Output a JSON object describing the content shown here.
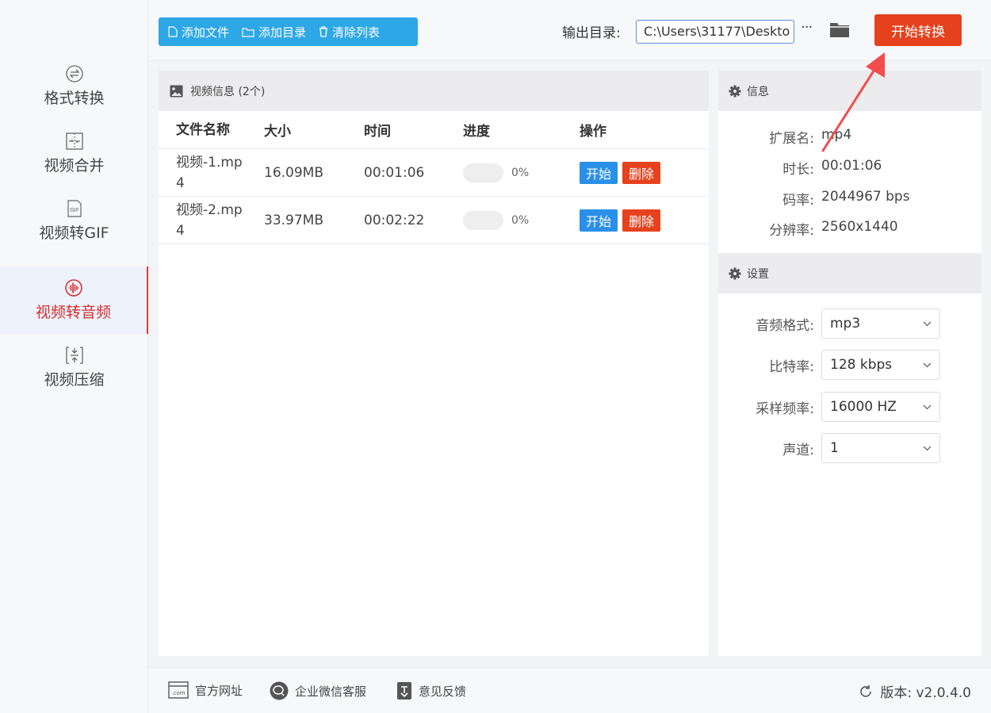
{
  "sidebar": {
    "items": [
      {
        "label": "格式转换",
        "icon": "format-convert-icon",
        "active": false
      },
      {
        "label": "视频合并",
        "icon": "video-merge-icon",
        "active": false
      },
      {
        "label": "视频转GIF",
        "icon": "gif-icon",
        "active": false
      },
      {
        "label": "视频转音频",
        "icon": "audio-wave-icon",
        "active": true
      },
      {
        "label": "视频压缩",
        "icon": "compress-icon",
        "active": false
      }
    ],
    "gif_icon_text": "GIF"
  },
  "toolbar": {
    "add_file": "添加文件",
    "add_folder": "添加目录",
    "clear_list": "清除列表",
    "output_label": "输出目录:",
    "output_path": "C:\\Users\\31177\\Deskto",
    "more": "···",
    "start_convert": "开始转换"
  },
  "file_panel": {
    "title": "视频信息 (2个)",
    "columns": [
      "文件名称",
      "大小",
      "时间",
      "进度",
      "操作"
    ],
    "rows": [
      {
        "name_line1": "视频-1.mp",
        "name_line2": "4",
        "size": "16.09MB",
        "time": "00:01:06",
        "progress": 0,
        "progress_text": "0%",
        "start": "开始",
        "delete": "删除"
      },
      {
        "name_line1": "视频-2.mp",
        "name_line2": "4",
        "size": "33.97MB",
        "time": "00:02:22",
        "progress": 0,
        "progress_text": "0%",
        "start": "开始",
        "delete": "删除"
      }
    ]
  },
  "info_panel": {
    "title": "信息",
    "items": [
      {
        "key": "扩展名:",
        "value": "mp4"
      },
      {
        "key": "时长:",
        "value": "00:01:06"
      },
      {
        "key": "码率:",
        "value": "2044967 bps"
      },
      {
        "key": "分辨率:",
        "value": "2560x1440"
      }
    ]
  },
  "settings_panel": {
    "title": "设置",
    "items": [
      {
        "key": "音频格式:",
        "value": "mp3"
      },
      {
        "key": "比特率:",
        "value": "128 kbps"
      },
      {
        "key": "采样频率:",
        "value": "16000 HZ"
      },
      {
        "key": "声道:",
        "value": "1"
      }
    ]
  },
  "footer": {
    "website": "官方网址",
    "website_icon_text": ".com",
    "wechat": "企业微信客服",
    "feedback": "意见反馈",
    "version": "版本: v2.0.4.0"
  },
  "colors": {
    "accent_blue": "#2ea7e6",
    "accent_red": "#e6411d",
    "active_red": "#d32f2f"
  }
}
